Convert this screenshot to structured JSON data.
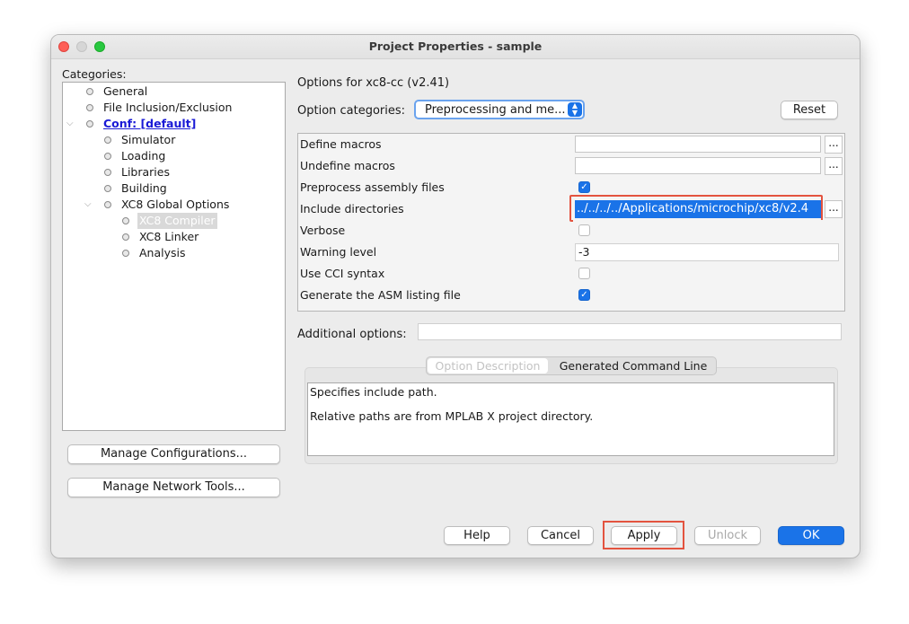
{
  "window": {
    "title": "Project Properties - sample"
  },
  "categories": {
    "label": "Categories:",
    "items": [
      {
        "label": "General"
      },
      {
        "label": "File Inclusion/Exclusion"
      },
      {
        "label": "Conf: [default]"
      },
      {
        "label": "Simulator"
      },
      {
        "label": "Loading"
      },
      {
        "label": "Libraries"
      },
      {
        "label": "Building"
      },
      {
        "label": "XC8 Global Options"
      },
      {
        "label": "XC8 Compiler"
      },
      {
        "label": "XC8 Linker"
      },
      {
        "label": "Analysis"
      }
    ],
    "manage_configurations": "Manage Configurations...",
    "manage_network_tools": "Manage Network Tools..."
  },
  "options": {
    "header": "Options for xc8-cc (v2.41)",
    "categories_label": "Option categories:",
    "categories_value": "Preprocessing and me...",
    "reset": "Reset",
    "rows": [
      {
        "name": "Define macros",
        "value": ""
      },
      {
        "name": "Undefine macros",
        "value": ""
      },
      {
        "name": "Preprocess assembly files",
        "checked": true
      },
      {
        "name": "Include directories",
        "value": "../../../../Applications/microchip/xc8/v2.4"
      },
      {
        "name": "Verbose",
        "checked": false
      },
      {
        "name": "Warning level",
        "value": "-3"
      },
      {
        "name": "Use CCI syntax",
        "checked": false
      },
      {
        "name": "Generate the ASM listing file",
        "checked": true
      }
    ],
    "ellipsis": "...",
    "additional_label": "Additional options:",
    "additional_value": ""
  },
  "description": {
    "tab_description": "Option Description",
    "tab_command_line": "Generated Command Line",
    "line1": "Specifies include path.",
    "line2": "Relative paths are from MPLAB X project directory."
  },
  "buttons": {
    "help": "Help",
    "cancel": "Cancel",
    "apply": "Apply",
    "unlock": "Unlock",
    "ok": "OK"
  },
  "colors": {
    "accent": "#1a73e8",
    "highlight_box": "#e3533f",
    "link": "#1a1ad6"
  }
}
